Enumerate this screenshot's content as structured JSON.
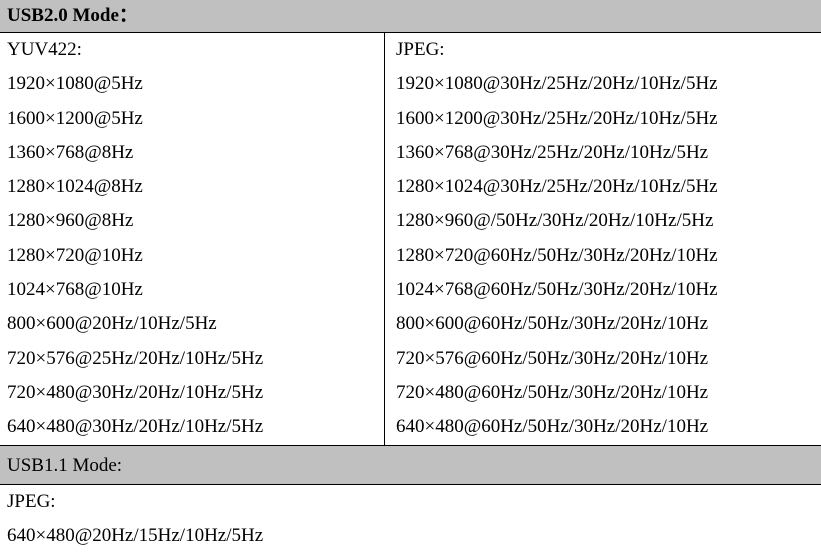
{
  "usb20": {
    "title": "USB2.0 Mode：",
    "left": {
      "header": "YUV422:",
      "items": [
        "1920×1080@5Hz",
        "1600×1200@5Hz",
        "1360×768@8Hz",
        "1280×1024@8Hz",
        "1280×960@8Hz",
        "1280×720@10Hz",
        "1024×768@10Hz",
        "800×600@20Hz/10Hz/5Hz",
        "720×576@25Hz/20Hz/10Hz/5Hz",
        "720×480@30Hz/20Hz/10Hz/5Hz",
        "640×480@30Hz/20Hz/10Hz/5Hz"
      ]
    },
    "right": {
      "header": "JPEG:",
      "items": [
        "1920×1080@30Hz/25Hz/20Hz/10Hz/5Hz",
        "1600×1200@30Hz/25Hz/20Hz/10Hz/5Hz",
        "1360×768@30Hz/25Hz/20Hz/10Hz/5Hz",
        "1280×1024@30Hz/25Hz/20Hz/10Hz/5Hz",
        "1280×960@/50Hz/30Hz/20Hz/10Hz/5Hz",
        "1280×720@60Hz/50Hz/30Hz/20Hz/10Hz",
        "1024×768@60Hz/50Hz/30Hz/20Hz/10Hz",
        "800×600@60Hz/50Hz/30Hz/20Hz/10Hz",
        "720×576@60Hz/50Hz/30Hz/20Hz/10Hz",
        "720×480@60Hz/50Hz/30Hz/20Hz/10Hz",
        "640×480@60Hz/50Hz/30Hz/20Hz/10Hz"
      ]
    }
  },
  "usb11": {
    "title": "USB1.1 Mode:",
    "header": "JPEG:",
    "items": [
      "640×480@20Hz/15Hz/10Hz/5Hz"
    ]
  }
}
